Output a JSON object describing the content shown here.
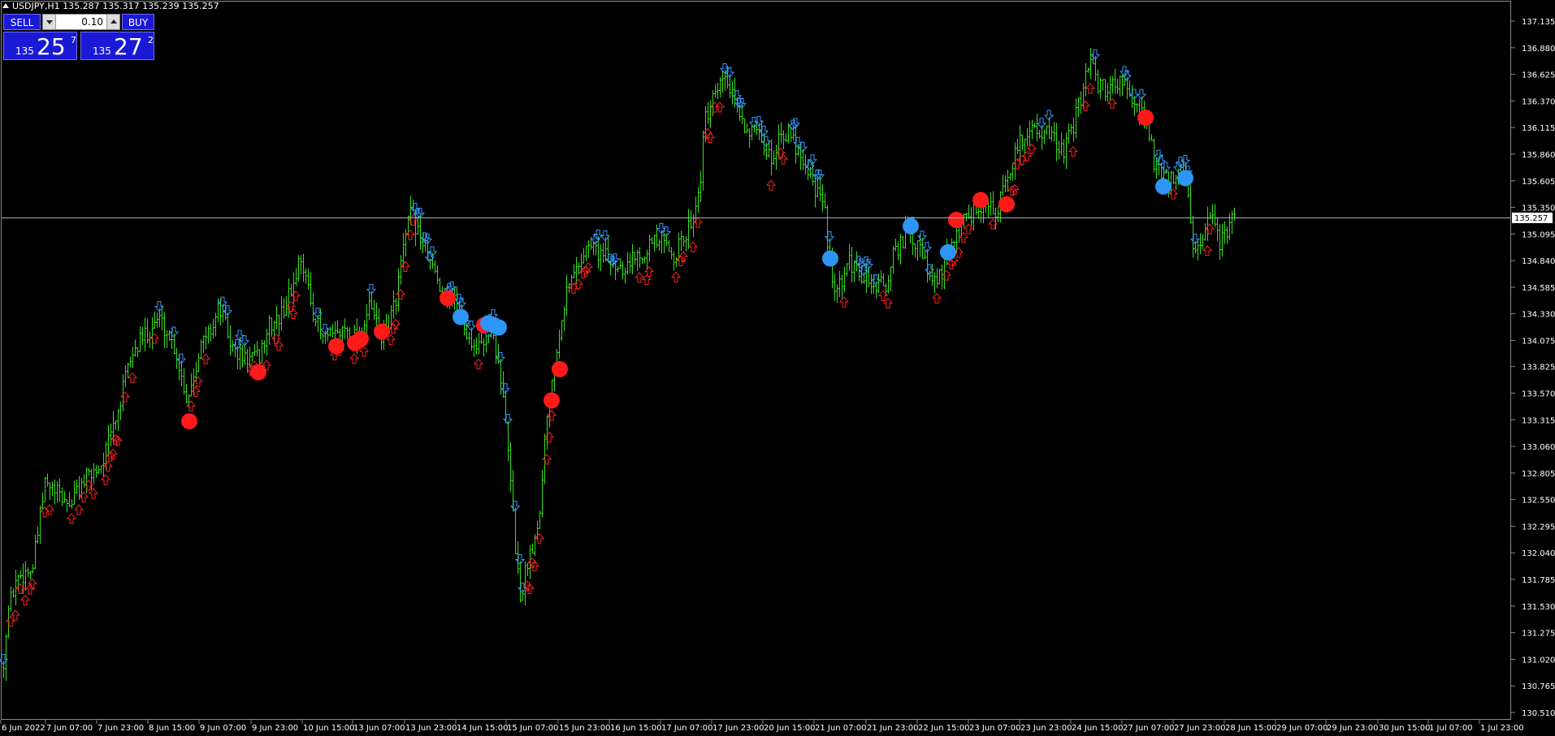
{
  "header": {
    "symbol_line": "USDJPY,H1  135.287 135.317 135.239 135.257"
  },
  "trade_panel": {
    "sell_label": "SELL",
    "buy_label": "BUY",
    "lot_value": "0.10",
    "sell_price": {
      "prefix": "135",
      "big": "25",
      "sup": "7"
    },
    "buy_price": {
      "prefix": "135",
      "big": "27",
      "sup": "2"
    }
  },
  "colors": {
    "background": "#000000",
    "candle": "#33e01a",
    "up_arrow": "#ff2020",
    "down_arrow": "#3399ff",
    "red_dot": "#ff1a1a",
    "blue_dot": "#2d95f5",
    "price_line": "#9ab3c8",
    "axis_text": "#ffffff",
    "panel_blue": "#1a1ad6"
  },
  "chart_data": {
    "type": "candlestick",
    "symbol": "USDJPY",
    "timeframe": "H1",
    "current_price": "135.257",
    "ylim": [
      130.52,
      137.3
    ],
    "y_ticks": [
      "137.135",
      "136.880",
      "136.625",
      "136.370",
      "136.115",
      "135.860",
      "135.605",
      "135.350",
      "135.095",
      "134.840",
      "134.585",
      "134.330",
      "134.075",
      "133.825",
      "133.570",
      "133.315",
      "133.060",
      "132.805",
      "132.550",
      "132.295",
      "132.040",
      "131.785",
      "131.530",
      "131.275",
      "131.020",
      "130.765",
      "130.510"
    ],
    "x_ticks": [
      "6 Jun 2022",
      "7 Jun 07:00",
      "7 Jun 23:00",
      "8 Jun 15:00",
      "9 Jun 07:00",
      "9 Jun 23:00",
      "10 Jun 15:00",
      "13 Jun 07:00",
      "13 Jun 23:00",
      "14 Jun 15:00",
      "15 Jun 07:00",
      "15 Jun 23:00",
      "16 Jun 15:00",
      "17 Jun 07:00",
      "17 Jun 23:00",
      "20 Jun 15:00",
      "21 Jun 07:00",
      "21 Jun 23:00",
      "22 Jun 15:00",
      "23 Jun 07:00",
      "23 Jun 23:00",
      "24 Jun 15:00",
      "27 Jun 07:00",
      "27 Jun 23:00",
      "28 Jun 15:00",
      "29 Jun 07:00",
      "29 Jun 23:00",
      "30 Jun 15:00",
      "1 Jul 07:00",
      "1 Jul 23:00"
    ],
    "price_path": [
      [
        0,
        130.7
      ],
      [
        10,
        131.5
      ],
      [
        20,
        131.8
      ],
      [
        40,
        131.9
      ],
      [
        55,
        132.7
      ],
      [
        70,
        132.6
      ],
      [
        85,
        132.5
      ],
      [
        100,
        132.7
      ],
      [
        125,
        132.9
      ],
      [
        145,
        133.4
      ],
      [
        160,
        133.9
      ],
      [
        175,
        134.1
      ],
      [
        195,
        134.3
      ],
      [
        215,
        134.0
      ],
      [
        230,
        133.5
      ],
      [
        245,
        134.0
      ],
      [
        260,
        134.2
      ],
      [
        270,
        134.4
      ],
      [
        285,
        134.0
      ],
      [
        300,
        133.9
      ],
      [
        318,
        133.9
      ],
      [
        330,
        134.2
      ],
      [
        345,
        134.3
      ],
      [
        360,
        134.6
      ],
      [
        370,
        134.9
      ],
      [
        380,
        134.5
      ],
      [
        395,
        134.1
      ],
      [
        410,
        134.1
      ],
      [
        425,
        134.2
      ],
      [
        440,
        134.1
      ],
      [
        455,
        134.4
      ],
      [
        470,
        134.1
      ],
      [
        485,
        134.4
      ],
      [
        495,
        134.9
      ],
      [
        505,
        135.3
      ],
      [
        520,
        135.0
      ],
      [
        535,
        134.7
      ],
      [
        550,
        134.5
      ],
      [
        565,
        134.4
      ],
      [
        575,
        134.1
      ],
      [
        590,
        134.0
      ],
      [
        605,
        134.2
      ],
      [
        615,
        133.8
      ],
      [
        625,
        133.0
      ],
      [
        635,
        132.0
      ],
      [
        640,
        131.6
      ],
      [
        650,
        132.0
      ],
      [
        662,
        132.3
      ],
      [
        672,
        133.3
      ],
      [
        682,
        133.9
      ],
      [
        695,
        134.5
      ],
      [
        710,
        134.8
      ],
      [
        725,
        135.0
      ],
      [
        740,
        134.9
      ],
      [
        755,
        134.8
      ],
      [
        770,
        134.8
      ],
      [
        785,
        134.9
      ],
      [
        800,
        135.0
      ],
      [
        815,
        135.0
      ],
      [
        830,
        134.9
      ],
      [
        845,
        135.1
      ],
      [
        860,
        135.5
      ],
      [
        868,
        136.2
      ],
      [
        880,
        136.4
      ],
      [
        892,
        136.6
      ],
      [
        905,
        136.3
      ],
      [
        920,
        136.1
      ],
      [
        935,
        136.0
      ],
      [
        950,
        135.8
      ],
      [
        960,
        136.1
      ],
      [
        975,
        136.0
      ],
      [
        990,
        135.8
      ],
      [
        1000,
        135.6
      ],
      [
        1015,
        135.3
      ],
      [
        1025,
        134.5
      ],
      [
        1035,
        134.6
      ],
      [
        1045,
        134.8
      ],
      [
        1060,
        134.7
      ],
      [
        1075,
        134.6
      ],
      [
        1090,
        134.6
      ],
      [
        1100,
        134.9
      ],
      [
        1115,
        135.1
      ],
      [
        1125,
        135.0
      ],
      [
        1135,
        134.9
      ],
      [
        1145,
        134.6
      ],
      [
        1158,
        134.7
      ],
      [
        1170,
        135.0
      ],
      [
        1180,
        135.2
      ],
      [
        1195,
        135.3
      ],
      [
        1210,
        135.4
      ],
      [
        1225,
        135.3
      ],
      [
        1240,
        135.6
      ],
      [
        1250,
        135.9
      ],
      [
        1265,
        136.1
      ],
      [
        1280,
        136.1
      ],
      [
        1295,
        136.0
      ],
      [
        1310,
        135.9
      ],
      [
        1320,
        136.1
      ],
      [
        1330,
        136.4
      ],
      [
        1340,
        136.8
      ],
      [
        1350,
        136.5
      ],
      [
        1365,
        136.5
      ],
      [
        1380,
        136.6
      ],
      [
        1395,
        136.3
      ],
      [
        1410,
        136.2
      ],
      [
        1420,
        135.8
      ],
      [
        1430,
        135.6
      ],
      [
        1445,
        135.6
      ],
      [
        1458,
        135.7
      ],
      [
        1468,
        135.0
      ],
      [
        1478,
        134.9
      ],
      [
        1488,
        135.3
      ],
      [
        1500,
        135.0
      ],
      [
        1515,
        135.2
      ],
      [
        1522,
        135.26
      ]
    ],
    "red_dots": [
      [
        233,
        133.3
      ],
      [
        318,
        133.77
      ],
      [
        414,
        134.02
      ],
      [
        437,
        134.05
      ],
      [
        444,
        134.09
      ],
      [
        470,
        134.16
      ],
      [
        551,
        134.48
      ],
      [
        596,
        134.22
      ],
      [
        679,
        133.5
      ],
      [
        689,
        133.8
      ],
      [
        1177,
        135.23
      ],
      [
        1207,
        135.42
      ],
      [
        1239,
        135.38
      ],
      [
        1410,
        136.21
      ]
    ],
    "blue_dots": [
      [
        567,
        134.3
      ],
      [
        601,
        134.24
      ],
      [
        608,
        134.22
      ],
      [
        614,
        134.2
      ],
      [
        1022,
        134.86
      ],
      [
        1121,
        135.17
      ],
      [
        1167,
        134.92
      ],
      [
        1432,
        135.55
      ],
      [
        1459,
        135.63
      ]
    ]
  }
}
